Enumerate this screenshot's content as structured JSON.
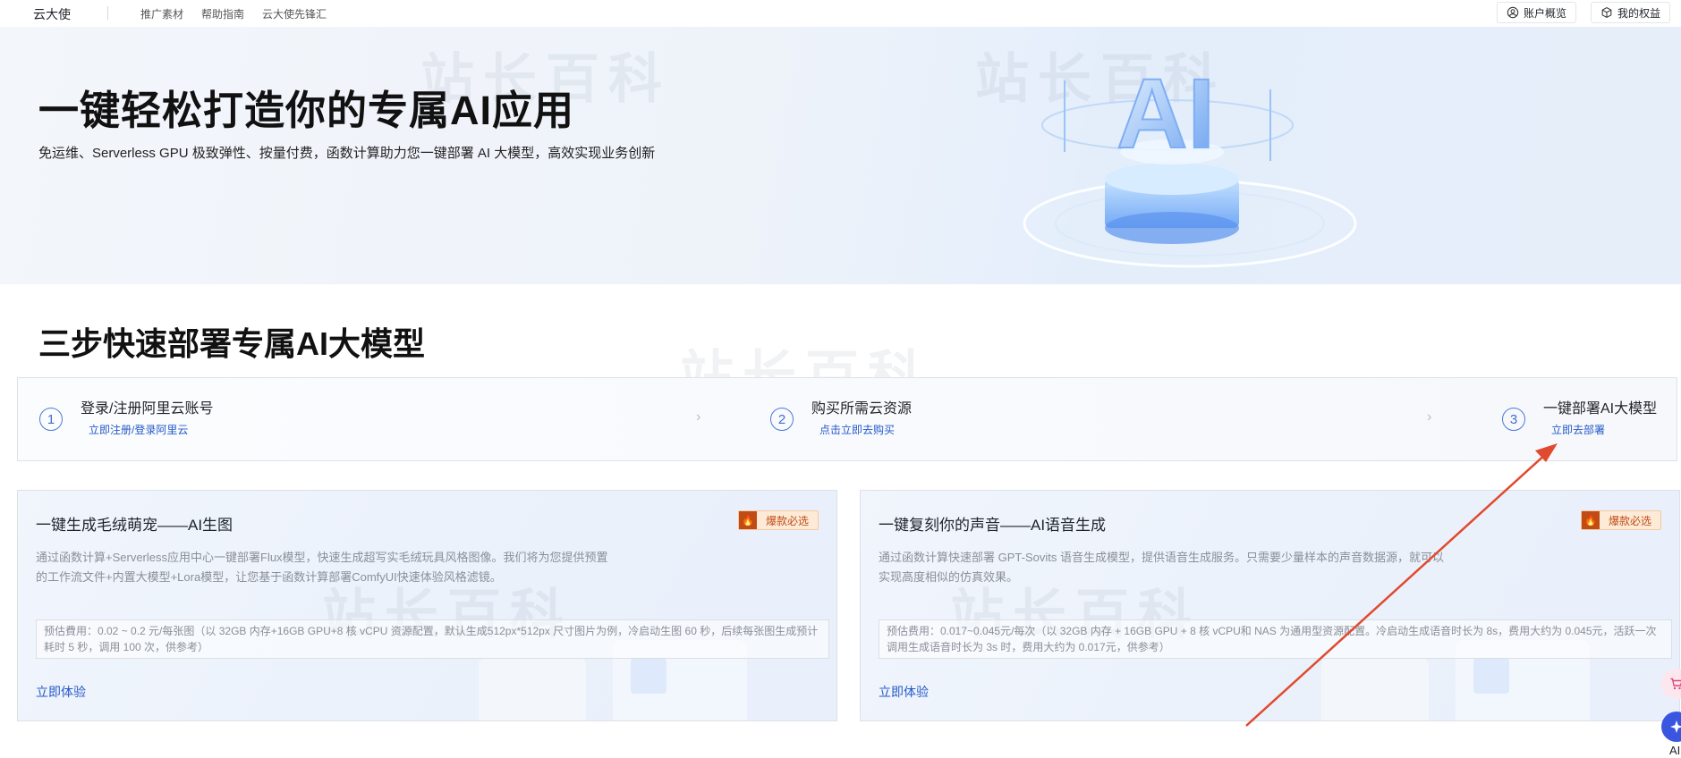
{
  "nav": {
    "brand": "云大使",
    "links": [
      "推广素材",
      "帮助指南",
      "云大使先锋汇"
    ],
    "account_btn": "账户概览",
    "rights_btn": "我的权益"
  },
  "hero": {
    "title": "一键轻松打造你的专属AI应用",
    "subtitle": "免运维、Serverless GPU 极致弹性、按量付费，函数计算助力您一键部署 AI 大模型，高效实现业务创新",
    "art_text": "AI"
  },
  "watermark": "站长百科",
  "steps": {
    "title": "三步快速部署专属AI大模型",
    "items": [
      {
        "num": "1",
        "label": "登录/注册阿里云账号",
        "link": "立即注册/登录阿里云"
      },
      {
        "num": "2",
        "label": "购买所需云资源",
        "link": "点击立即去购买"
      },
      {
        "num": "3",
        "label": "一键部署AI大模型",
        "link": "立即去部署"
      }
    ],
    "separator": "›"
  },
  "cards": [
    {
      "title": "一键生成毛绒萌宠——AI生图",
      "badge": "爆款必选",
      "desc": "通过函数计算+Serverless应用中心一键部署Flux模型，快速生成超写实毛绒玩具风格图像。我们将为您提供预置的工作流文件+内置大模型+Lora模型，让您基于函数计算部署ComfyUI快速体验风格滤镜。",
      "price": "预估費用：0.02 ~ 0.2 元/每张图（以 32GB 内存+16GB GPU+8 核 vCPU 资源配置，默认生成512px*512px 尺寸图片为例，冷启动生图 60 秒，后续每张图生成预计耗时 5 秒，调用 100 次，供参考）",
      "cta": "立即体验"
    },
    {
      "title": "一键复刻你的声音——AI语音生成",
      "badge": "爆款必选",
      "desc": "通过函数计算快速部署 GPT-Sovits 语音生成模型，提供语音生成服务。只需要少量样本的声音数据源，就可以实现高度相似的仿真效果。",
      "price": "预估费用：0.017~0.045元/每次（以 32GB 内存 + 16GB GPU + 8 核 vCPU和 NAS 为通用型资源配置。冷启动生成语音时长为 8s，费用大约为 0.045元，活跃一次调用生成语音时长为 3s 时，费用大约为 0.017元，供参考）",
      "cta": "立即体验"
    }
  ],
  "floaters": {
    "ai_label": "AI"
  },
  "colors": {
    "link": "#2559c9",
    "badge_fire": "#c14b14",
    "annotation_arrow": "#e04a2f"
  }
}
